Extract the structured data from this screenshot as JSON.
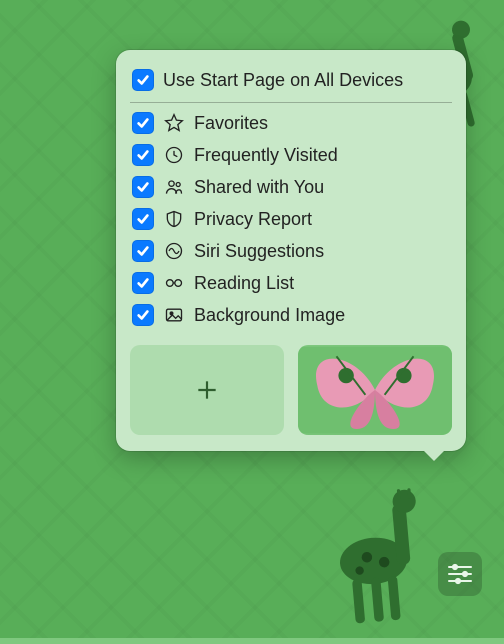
{
  "popover": {
    "top_option": {
      "label": "Use Start Page on All Devices",
      "checked": true
    },
    "items": [
      {
        "icon": "star-icon",
        "label": "Favorites",
        "checked": true
      },
      {
        "icon": "clock-icon",
        "label": "Frequently Visited",
        "checked": true
      },
      {
        "icon": "people-icon",
        "label": "Shared with You",
        "checked": true
      },
      {
        "icon": "shield-icon",
        "label": "Privacy Report",
        "checked": true
      },
      {
        "icon": "siri-icon",
        "label": "Siri Suggestions",
        "checked": true
      },
      {
        "icon": "glasses-icon",
        "label": "Reading List",
        "checked": true
      },
      {
        "icon": "image-icon",
        "label": "Background Image",
        "checked": true
      }
    ],
    "thumbnails": {
      "add_label": "Add custom background",
      "preview_label": "Butterfly wallpaper"
    }
  },
  "controls": {
    "settings_button": "Customize Start Page"
  },
  "colors": {
    "accent": "#0a7aff",
    "popover_bg": "#c8e8c8",
    "page_bg": "#7fc87f"
  }
}
